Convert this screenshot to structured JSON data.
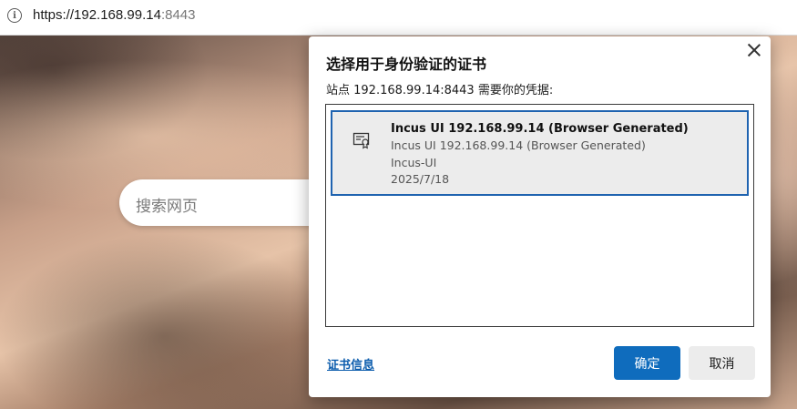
{
  "addressbar": {
    "url_host": "https://192.168.99.14",
    "url_port": ":8443",
    "info_icon": "info-icon"
  },
  "page": {
    "search_placeholder": "搜索网页"
  },
  "dialog": {
    "title": "选择用于身份验证的证书",
    "subtitle": "站点 192.168.99.14:8443 需要你的凭据:",
    "certificates": [
      {
        "icon": "certificate-icon",
        "name": "Incus UI 192.168.99.14 (Browser Generated)",
        "issuer": "Incus UI 192.168.99.14 (Browser Generated)",
        "organization": "Incus-UI",
        "date": "2025/7/18",
        "selected": true
      }
    ],
    "cert_info_link": "证书信息",
    "ok_label": "确定",
    "cancel_label": "取消",
    "close_icon": "close-icon"
  },
  "colors": {
    "accent": "#0f6cbd",
    "selection_border": "#1f63b0",
    "link": "#0b5cad"
  }
}
